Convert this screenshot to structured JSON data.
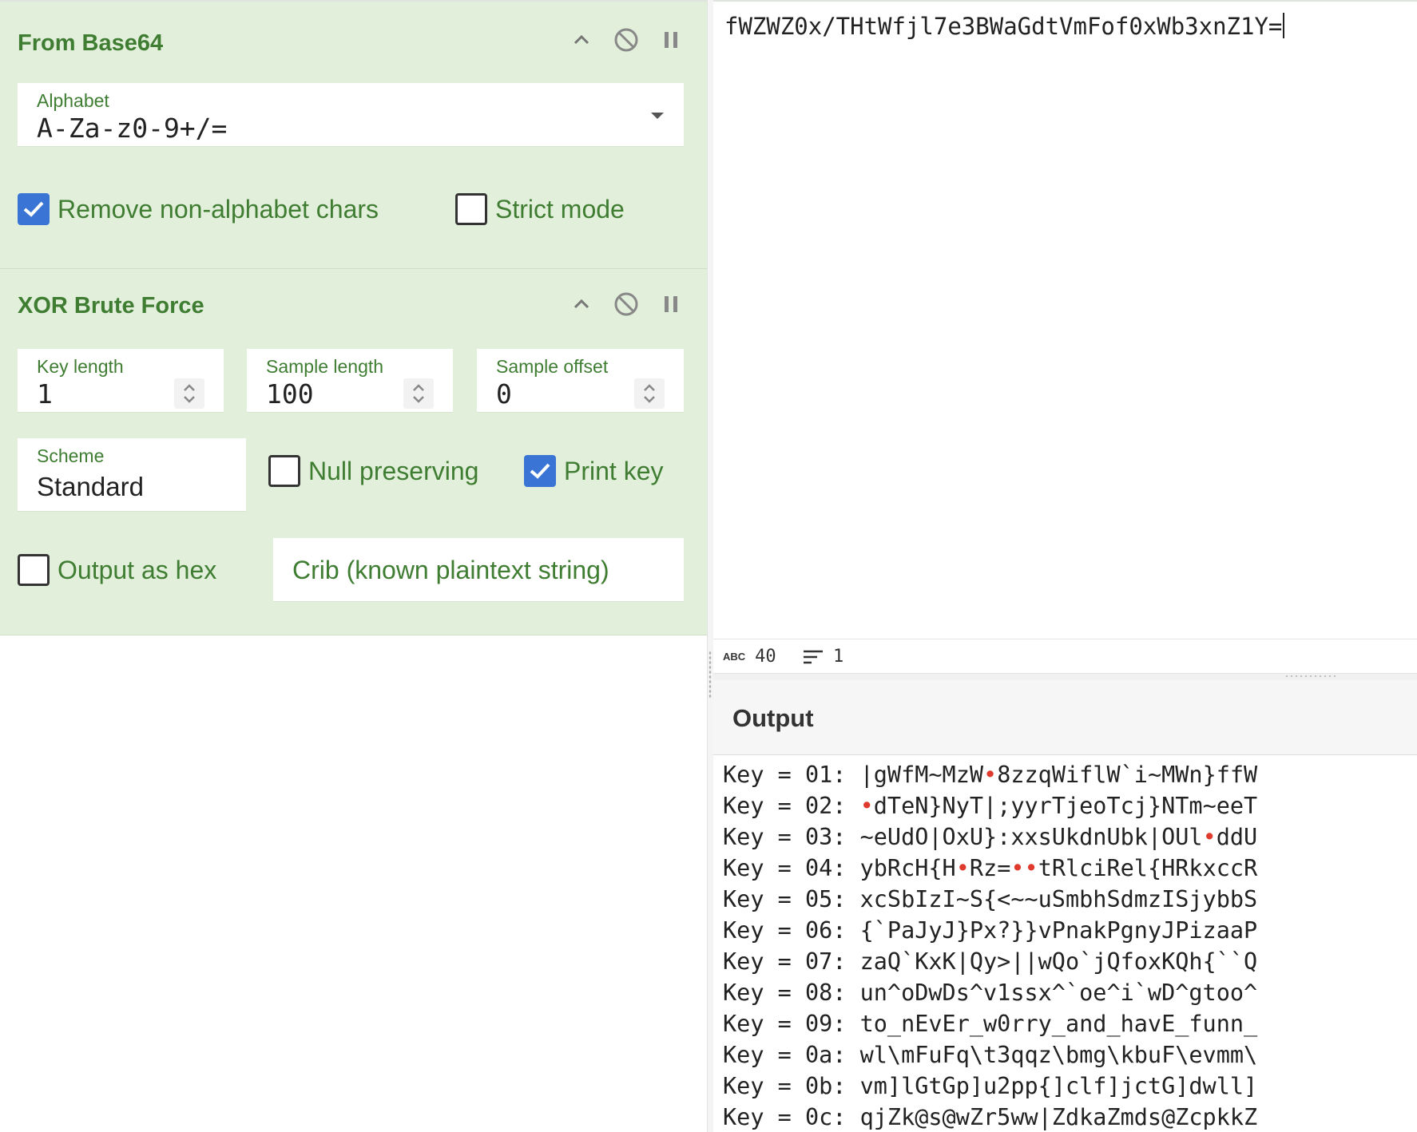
{
  "recipe": {
    "from_base64": {
      "title": "From Base64",
      "alphabet": {
        "label": "Alphabet",
        "value": "A-Za-z0-9+/="
      },
      "remove_non_alphabet": {
        "label": "Remove non-alphabet chars",
        "checked": true
      },
      "strict_mode": {
        "label": "Strict mode",
        "checked": false
      }
    },
    "xor_brute_force": {
      "title": "XOR Brute Force",
      "key_length": {
        "label": "Key length",
        "value": "1"
      },
      "sample_length": {
        "label": "Sample length",
        "value": "100"
      },
      "sample_offset": {
        "label": "Sample offset",
        "value": "0"
      },
      "scheme": {
        "label": "Scheme",
        "value": "Standard"
      },
      "null_preserving": {
        "label": "Null preserving",
        "checked": false
      },
      "print_key": {
        "label": "Print key",
        "checked": true
      },
      "output_as_hex": {
        "label": "Output as hex",
        "checked": false
      },
      "crib": {
        "placeholder": "Crib (known plaintext string)"
      }
    }
  },
  "input": {
    "text": "fWZWZ0x/THtWfjl7e3BWaGdtVmFof0xWb3xnZ1Y="
  },
  "status": {
    "length_icon": "ABC",
    "length": "40",
    "lines": "1"
  },
  "output": {
    "title": "Output",
    "lines": [
      {
        "prefix": "Key = 01: ",
        "segments": [
          "|gWfM~MzW",
          "•",
          "8zzqWiflW`i~MWn}ffW"
        ]
      },
      {
        "prefix": "Key = 02: ",
        "segments": [
          "",
          "•",
          "dTeN}NyT|;yyrTjeoTcj}NTm~eeT"
        ]
      },
      {
        "prefix": "Key = 03: ",
        "segments": [
          "~eUdO|OxU}:xxsUkdnUbk|OUl",
          "•",
          "ddU"
        ]
      },
      {
        "prefix": "Key = 04: ",
        "segments": [
          "ybRcH{H",
          "•",
          "Rz=",
          "••",
          "tRlciRel{HRkxccR"
        ]
      },
      {
        "prefix": "Key = 05: ",
        "segments": [
          "xcSbIzI~S{<~~uSmbhSdmzISjybbS"
        ]
      },
      {
        "prefix": "Key = 06: ",
        "segments": [
          "{`PaJyJ}Px?}}vPnakPgnyJPizaaP"
        ]
      },
      {
        "prefix": "Key = 07: ",
        "segments": [
          "zaQ`KxK|Qy>||wQo`jQfoxKQh{``Q"
        ]
      },
      {
        "prefix": "Key = 08: ",
        "segments": [
          "un^oDwDs^v1ssx^`oe^i`wD^gtoo^"
        ]
      },
      {
        "prefix": "Key = 09: ",
        "segments": [
          "to_nEvEr_w0rry_and_havE_funn_"
        ]
      },
      {
        "prefix": "Key = 0a: ",
        "segments": [
          "wl\\mFuFq\\t3qqz\\bmg\\kbuF\\evmm\\"
        ]
      },
      {
        "prefix": "Key = 0b: ",
        "segments": [
          "vm]lGtGp]u2pp{]clf]jctG]dwll]"
        ]
      },
      {
        "prefix": "Key = 0c: ",
        "segments": [
          "qjZk@s@wZr5ww|ZdkaZmds@ZcpkkZ"
        ]
      }
    ]
  }
}
